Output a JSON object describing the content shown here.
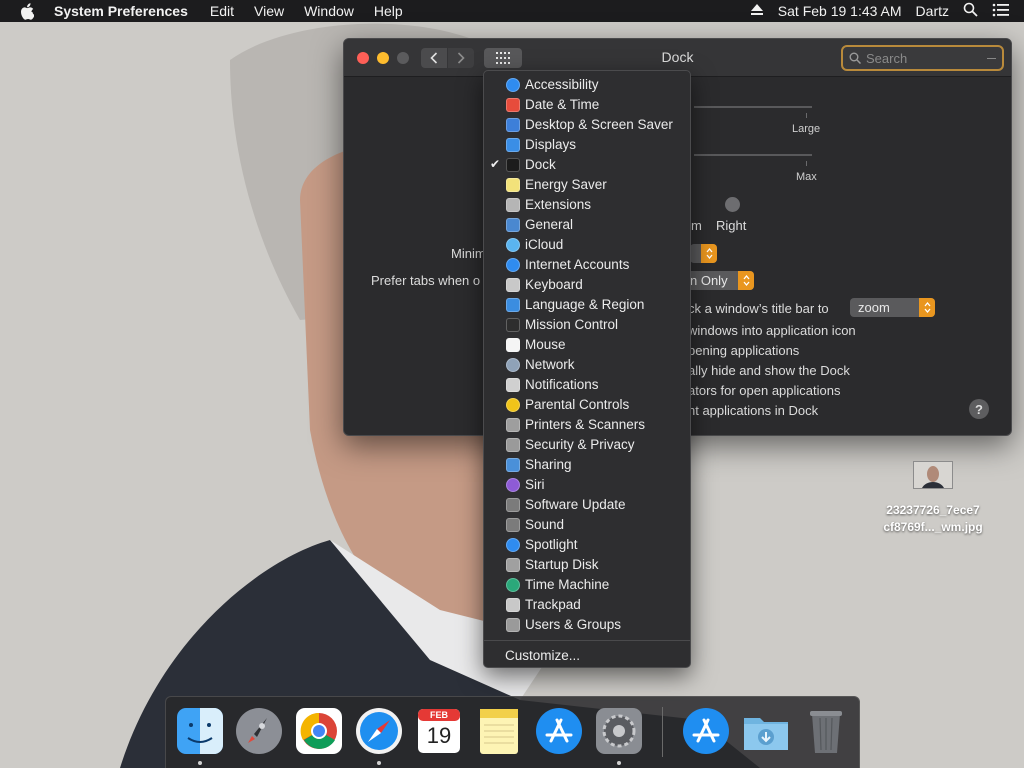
{
  "menubar": {
    "app_name": "System Preferences",
    "menus": [
      "Edit",
      "View",
      "Window",
      "Help"
    ],
    "datetime": "Sat Feb 19  1:43 AM",
    "user": "Dartz"
  },
  "window": {
    "title": "Dock",
    "search_placeholder": "Search",
    "partial_texts": {
      "size_large": "Large",
      "mag_max": "Max",
      "pos_bottom_partial": "m",
      "pos_right": "Right",
      "minimize_partial": "Minim",
      "prefer_tabs_partial": "Prefer tabs when o",
      "prefer_tabs_value_partial": "n Only",
      "double_click_partial": "ck a window’s title bar to",
      "double_click_value": "zoom",
      "minimize_into_icon_partial": "windows into application icon",
      "animate_partial": "pening applications",
      "autohide_partial": "ally hide and show the Dock",
      "indicators_partial": "ators for open applications",
      "recent_partial": "nt applications in Dock"
    },
    "help_label": "?"
  },
  "pane_menu": {
    "selected": "Dock",
    "items": [
      {
        "label": "Accessibility",
        "icon": "accessibility-icon",
        "color": "#2f8cf0"
      },
      {
        "label": "Date & Time",
        "icon": "date-time-icon",
        "color": "#e74c3c"
      },
      {
        "label": "Desktop & Screen Saver",
        "icon": "desktop-icon",
        "color": "#3d7fd9"
      },
      {
        "label": "Displays",
        "icon": "displays-icon",
        "color": "#3a8ee6"
      },
      {
        "label": "Dock",
        "icon": "dock-icon",
        "color": "#1c1c1c"
      },
      {
        "label": "Energy Saver",
        "icon": "energy-saver-icon",
        "color": "#f2e27a"
      },
      {
        "label": "Extensions",
        "icon": "extensions-icon",
        "color": "#b5b5b5"
      },
      {
        "label": "General",
        "icon": "general-icon",
        "color": "#4a88d0"
      },
      {
        "label": "iCloud",
        "icon": "icloud-icon",
        "color": "#5ab4f0"
      },
      {
        "label": "Internet Accounts",
        "icon": "internet-accounts-icon",
        "color": "#2f8cf0"
      },
      {
        "label": "Keyboard",
        "icon": "keyboard-icon",
        "color": "#c8c8c8"
      },
      {
        "label": "Language & Region",
        "icon": "language-region-icon",
        "color": "#3b8de0"
      },
      {
        "label": "Mission Control",
        "icon": "mission-control-icon",
        "color": "#2e2e2e"
      },
      {
        "label": "Mouse",
        "icon": "mouse-icon",
        "color": "#f5f5f5"
      },
      {
        "label": "Network",
        "icon": "network-icon",
        "color": "#8fa2b8"
      },
      {
        "label": "Notifications",
        "icon": "notifications-icon",
        "color": "#d0d0d0"
      },
      {
        "label": "Parental Controls",
        "icon": "parental-controls-icon",
        "color": "#f0c419"
      },
      {
        "label": "Printers & Scanners",
        "icon": "printers-scanners-icon",
        "color": "#9e9e9e"
      },
      {
        "label": "Security & Privacy",
        "icon": "security-privacy-icon",
        "color": "#9a9a9a"
      },
      {
        "label": "Sharing",
        "icon": "sharing-icon",
        "color": "#4a90d9"
      },
      {
        "label": "Siri",
        "icon": "siri-icon",
        "color": "#8e5bd6"
      },
      {
        "label": "Software Update",
        "icon": "software-update-icon",
        "color": "#7b7b7b"
      },
      {
        "label": "Sound",
        "icon": "sound-icon",
        "color": "#7b7b7b"
      },
      {
        "label": "Spotlight",
        "icon": "spotlight-icon",
        "color": "#2f8cf0"
      },
      {
        "label": "Startup Disk",
        "icon": "startup-disk-icon",
        "color": "#a0a0a0"
      },
      {
        "label": "Time Machine",
        "icon": "time-machine-icon",
        "color": "#2aa87a"
      },
      {
        "label": "Trackpad",
        "icon": "trackpad-icon",
        "color": "#c8c8c8"
      },
      {
        "label": "Users & Groups",
        "icon": "users-groups-icon",
        "color": "#9a9a9a"
      }
    ],
    "customize_label": "Customize..."
  },
  "desktop_file": {
    "name_line1": "23237726_7ece7",
    "name_line2": "cf8769f..._wm.jpg"
  },
  "dock": {
    "apps": [
      {
        "name": "finder-icon",
        "running": true
      },
      {
        "name": "launchpad-icon",
        "running": false
      },
      {
        "name": "chrome-icon",
        "running": false
      },
      {
        "name": "safari-icon",
        "running": true
      },
      {
        "name": "calendar-icon",
        "running": false,
        "month": "FEB",
        "day": "19"
      },
      {
        "name": "notes-icon",
        "running": false
      },
      {
        "name": "app-store-icon",
        "running": false
      },
      {
        "name": "system-preferences-icon",
        "running": true
      },
      {
        "name": "app-store-downloads-icon",
        "running": false
      },
      {
        "name": "downloads-folder-icon",
        "running": false
      },
      {
        "name": "trash-icon",
        "running": false
      }
    ]
  },
  "colors": {
    "accent_orange": "#e9961f",
    "menu_bg": "#2e2e30",
    "window_bg": "#2b2b2d"
  }
}
